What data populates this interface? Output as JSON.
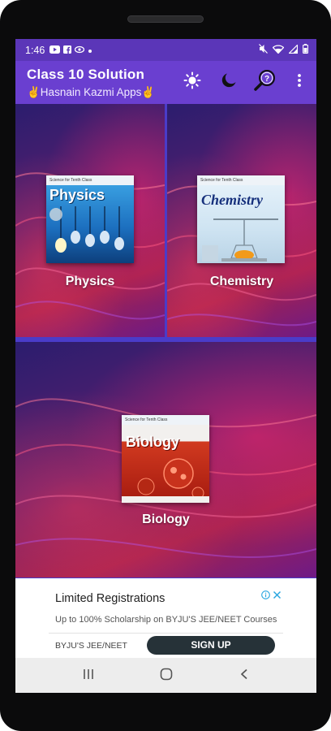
{
  "status_bar": {
    "time": "1:46",
    "left_icons": [
      "youtube-icon",
      "facebook-icon",
      "cast-icon",
      "dot-icon"
    ],
    "right_icons": [
      "mute-icon",
      "wifi-icon",
      "signal-icon",
      "battery-icon"
    ]
  },
  "app_bar": {
    "title": "Class 10 Solution",
    "subtitle": "✌Hasnain Kazmi Apps✌",
    "actions": [
      "brightness-icon",
      "dark-mode-icon",
      "search-icon",
      "more-options-icon"
    ]
  },
  "subjects": [
    {
      "label": "Physics",
      "cover_title": "Physics",
      "cover_header": "Science for Tenth Class"
    },
    {
      "label": "Chemistry",
      "cover_title": "Chemistry",
      "cover_header": "Science for Tenth Class"
    },
    {
      "label": "Biology",
      "cover_title": "Biology",
      "cover_header": "Science for Tenth Class"
    }
  ],
  "ad": {
    "title": "Limited Registrations",
    "description": "Up to 100% Scholarship on BYJU'S JEE/NEET Courses",
    "brand": "BYJU'S JEE/NEET",
    "cta": "SIGN UP"
  },
  "nav_bar": {
    "buttons": [
      "recent-apps-icon",
      "home-icon",
      "back-icon"
    ]
  },
  "colors": {
    "status_bar": "#5b36b8",
    "app_bar": "#6a3fd0",
    "grid_divider": "#4a3cc9",
    "ad_cta": "#263238"
  }
}
